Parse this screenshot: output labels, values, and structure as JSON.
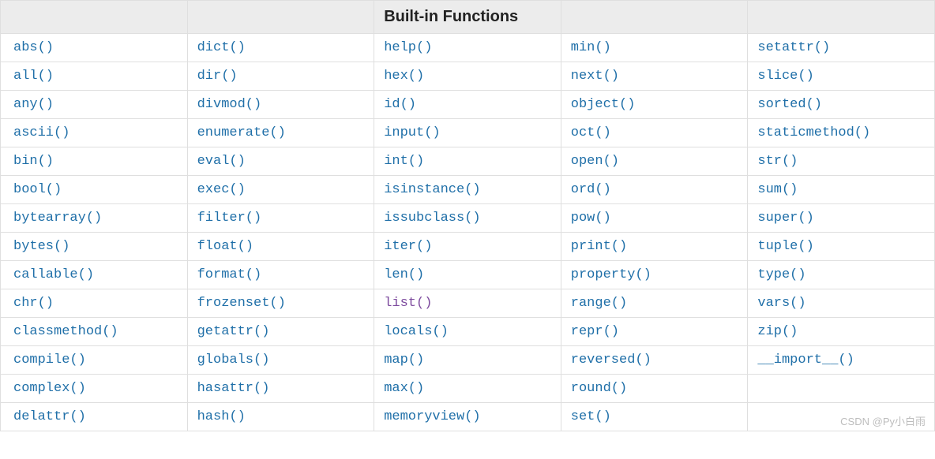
{
  "header": {
    "col1": "",
    "col2": "",
    "col3": "Built-in Functions",
    "col4": "",
    "col5": ""
  },
  "rows": [
    {
      "c1": "abs()",
      "c2": "dict()",
      "c3": "help()",
      "c4": "min()",
      "c5": "setattr()"
    },
    {
      "c1": "all()",
      "c2": "dir()",
      "c3": "hex()",
      "c4": "next()",
      "c5": "slice()"
    },
    {
      "c1": "any()",
      "c2": "divmod()",
      "c3": "id()",
      "c4": "object()",
      "c5": "sorted()"
    },
    {
      "c1": "ascii()",
      "c2": "enumerate()",
      "c3": "input()",
      "c4": "oct()",
      "c5": "staticmethod()"
    },
    {
      "c1": "bin()",
      "c2": "eval()",
      "c3": "int()",
      "c4": "open()",
      "c5": "str()"
    },
    {
      "c1": "bool()",
      "c2": "exec()",
      "c3": "isinstance()",
      "c4": "ord()",
      "c5": "sum()"
    },
    {
      "c1": "bytearray()",
      "c2": "filter()",
      "c3": "issubclass()",
      "c4": "pow()",
      "c5": "super()"
    },
    {
      "c1": "bytes()",
      "c2": "float()",
      "c3": "iter()",
      "c4": "print()",
      "c5": "tuple()"
    },
    {
      "c1": "callable()",
      "c2": "format()",
      "c3": "len()",
      "c4": "property()",
      "c5": "type()"
    },
    {
      "c1": "chr()",
      "c2": "frozenset()",
      "c3": "list()",
      "c3_visited": true,
      "c4": "range()",
      "c5": "vars()"
    },
    {
      "c1": "classmethod()",
      "c2": "getattr()",
      "c3": "locals()",
      "c4": "repr()",
      "c5": "zip()"
    },
    {
      "c1": "compile()",
      "c2": "globals()",
      "c3": "map()",
      "c4": "reversed()",
      "c5": "__import__()"
    },
    {
      "c1": "complex()",
      "c2": "hasattr()",
      "c3": "max()",
      "c4": "round()",
      "c5": ""
    },
    {
      "c1": "delattr()",
      "c2": "hash()",
      "c3": "memoryview()",
      "c4": "set()",
      "c5": ""
    }
  ],
  "watermark": "CSDN @Py小白雨"
}
